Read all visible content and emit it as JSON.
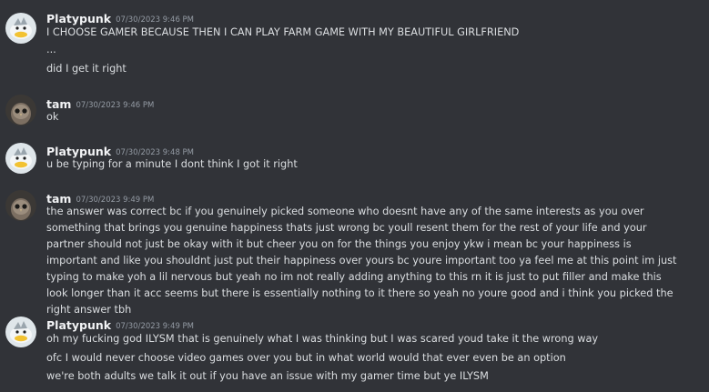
{
  "messages": [
    {
      "user": "Platypunk",
      "avatar": "platypus-avatar",
      "time": "07/30/2023 9:46 PM",
      "lines": [
        "I CHOOSE GAMER BECAUSE THEN I CAN PLAY FARM GAME WITH MY BEAUTIFUL GIRLFRIEND",
        "...",
        "did I get it right"
      ]
    },
    {
      "user": "tam",
      "avatar": "owl-avatar",
      "time": "07/30/2023 9:46 PM",
      "lines": [
        "ok"
      ]
    },
    {
      "user": "Platypunk",
      "avatar": "platypus-avatar",
      "time": "07/30/2023 9:48 PM",
      "lines": [
        "u be typing for a minute I dont think I got it right"
      ]
    },
    {
      "user": "tam",
      "avatar": "owl-avatar",
      "time": "07/30/2023 9:49 PM",
      "lines": [
        "the answer was correct bc if you genuinely picked someone who doesnt have any of the same interests as you over something that brings you genuine happiness thats just wrong bc youll resent them for the rest of your life and your partner should not just be okay with it but cheer you on for the things you enjoy ykw i mean bc your happiness is important and like you shouldnt just put their happiness over yours bc youre important too ya feel me at this point im just typing to make yoh a lil nervous but yeah no im not really adding anything to this rn it is just to put filler and make this look longer than it acc seems but there is essentially nothing to it there so yeah no youre good and i think you picked the right answer tbh"
      ]
    },
    {
      "user": "Platypunk",
      "avatar": "platypus-avatar",
      "time": "07/30/2023 9:49 PM",
      "lines": [
        "oh my fucking god ILYSM that is genuinely what I was thinking but I was scared youd take it the wrong way",
        "ofc I would never choose video games over you but in what world would that ever even be an option",
        "we're both adults we talk it out if you have an issue with my gamer time but ye ILYSM"
      ]
    }
  ]
}
